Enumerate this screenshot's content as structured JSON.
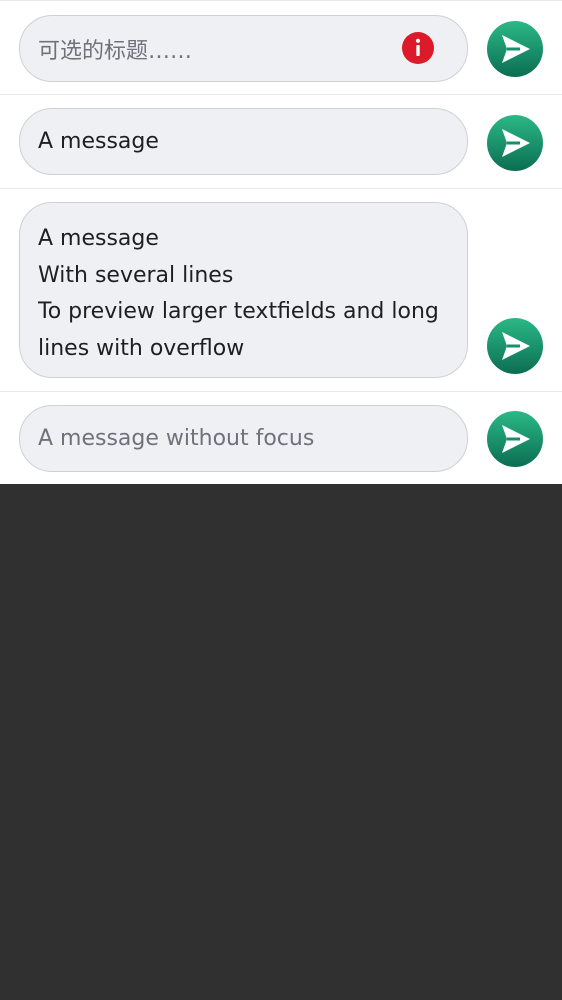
{
  "rows": [
    {
      "placeholder": "可选的标题……",
      "value": "",
      "error": true,
      "error_color": "#dc1a2a",
      "send_icon": "send-arrow-icon"
    },
    {
      "value": "A message",
      "send_icon": "send-arrow-icon"
    },
    {
      "lines": [
        "A message",
        "With several lines",
        "To preview larger textfields and long",
        "lines with overflow"
      ],
      "send_icon": "send-arrow-icon"
    },
    {
      "placeholder": "A message without focus",
      "value": "",
      "send_icon": "send-arrow-icon"
    }
  ],
  "colors": {
    "send_gradient_top": "#2bb886",
    "send_gradient_bottom": "#0b6e52",
    "field_background": "#eff0f4",
    "backdrop": "#303030"
  }
}
